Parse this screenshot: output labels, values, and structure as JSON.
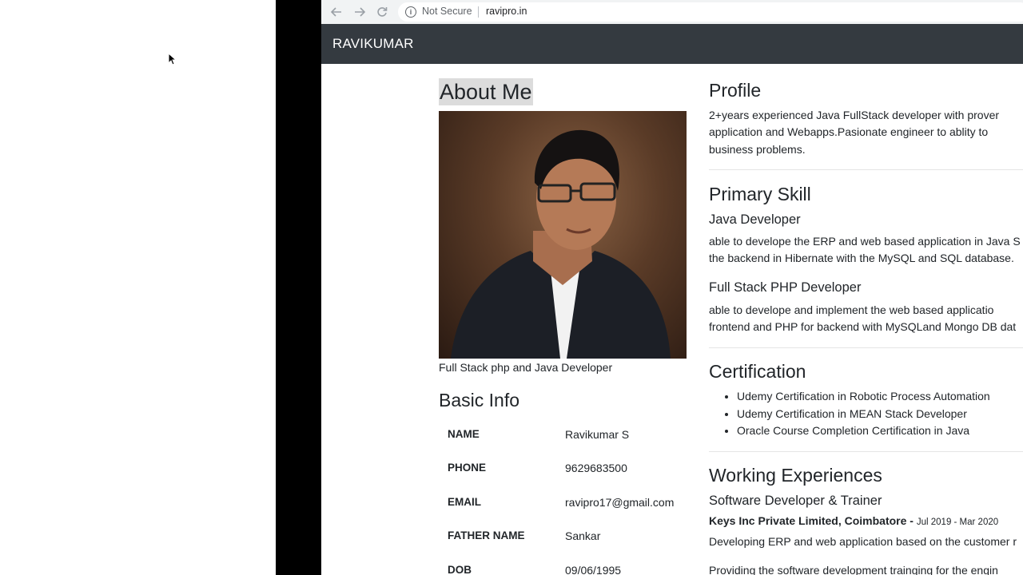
{
  "browser": {
    "security_label": "Not Secure",
    "url": "ravipro.in",
    "info_symbol": "i"
  },
  "site": {
    "brand": "RAVIKUMAR"
  },
  "about": {
    "heading": "About Me",
    "caption": "Full Stack php and Java Developer"
  },
  "basic_info": {
    "heading": "Basic Info",
    "rows": [
      {
        "label": "NAME",
        "value": "Ravikumar S"
      },
      {
        "label": "PHONE",
        "value": "9629683500"
      },
      {
        "label": "EMAIL",
        "value": "ravipro17@gmail.com"
      },
      {
        "label": "FATHER NAME",
        "value": "Sankar"
      },
      {
        "label": "DOB",
        "value": "09/06/1995"
      }
    ]
  },
  "profile": {
    "heading": "Profile",
    "lines": [
      "2+years experienced Java FullStack developer with prover",
      "application and Webapps.Pasionate engineer to ablity to",
      "business problems."
    ]
  },
  "primary_skill": {
    "heading": "Primary Skill",
    "skills": [
      {
        "title": "Java Developer",
        "lines": [
          "able to develope the ERP and web based application in Java S",
          "the backend in Hibernate with the MySQL and SQL database."
        ]
      },
      {
        "title": "Full Stack PHP Developer",
        "lines": [
          "able to develope and implement the web based applicatio",
          "frontend and PHP for backend with MySQLand Mongo DB dat"
        ]
      }
    ]
  },
  "certification": {
    "heading": "Certification",
    "items": [
      "Udemy Certification in Robotic Process Automation",
      "Udemy Certification in MEAN Stack Developer",
      "Oracle Course Completion Certification in Java"
    ]
  },
  "experience": {
    "heading": "Working Experiences",
    "role": "Software Developer & Trainer",
    "company": "Keys Inc Private Limited, Coimbatore -",
    "dates": "Jul 2019 - Mar 2020",
    "lines": [
      "Developing ERP and web application based on the customer r",
      "Providing the software development trainging for the engin"
    ]
  },
  "colors": {
    "navbar": "#343a40",
    "chrome": "#f1f3f4",
    "heading_highlight": "#dcdcdc"
  },
  "icons": [
    "back-arrow-icon",
    "forward-arrow-icon",
    "reload-icon",
    "info-icon",
    "mouse-cursor-icon"
  ]
}
